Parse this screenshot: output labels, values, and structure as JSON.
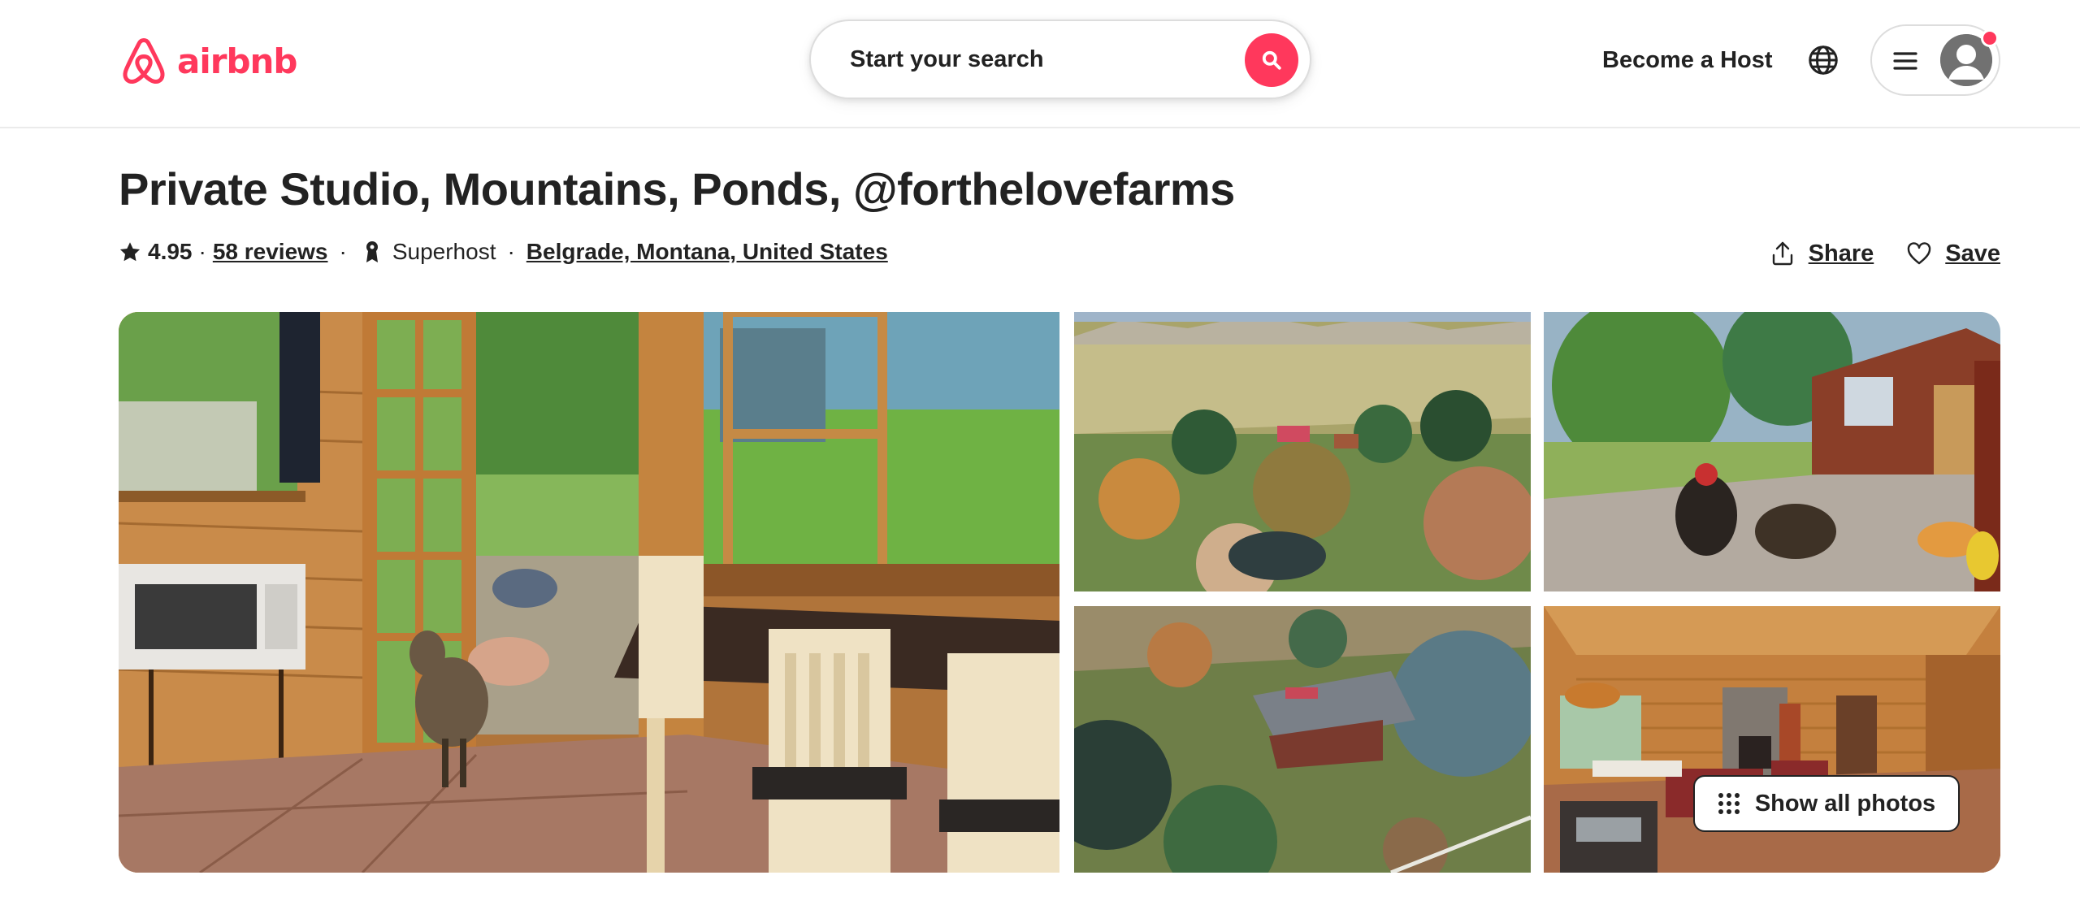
{
  "header": {
    "logo_text": "airbnb",
    "search_placeholder": "Start your search",
    "become_host": "Become a Host"
  },
  "listing": {
    "title": "Private Studio, Mountains, Ponds, @forthelovefarms",
    "rating": "4.95",
    "rating_sep": "·",
    "reviews": "58 reviews",
    "superhost": "Superhost",
    "location": "Belgrade, Montana, United States",
    "dot": "·"
  },
  "actions": {
    "share": "Share",
    "save": "Save"
  },
  "gallery": {
    "show_all": "Show all photos"
  },
  "colors": {
    "brand": "#ff385c",
    "text": "#222222",
    "border": "#dddddd"
  },
  "icons": [
    "airbnb-logo-icon",
    "search-icon",
    "globe-icon",
    "hamburger-icon",
    "avatar-icon",
    "star-icon",
    "superhost-medal-icon",
    "share-icon",
    "heart-icon",
    "grid-dots-icon"
  ]
}
